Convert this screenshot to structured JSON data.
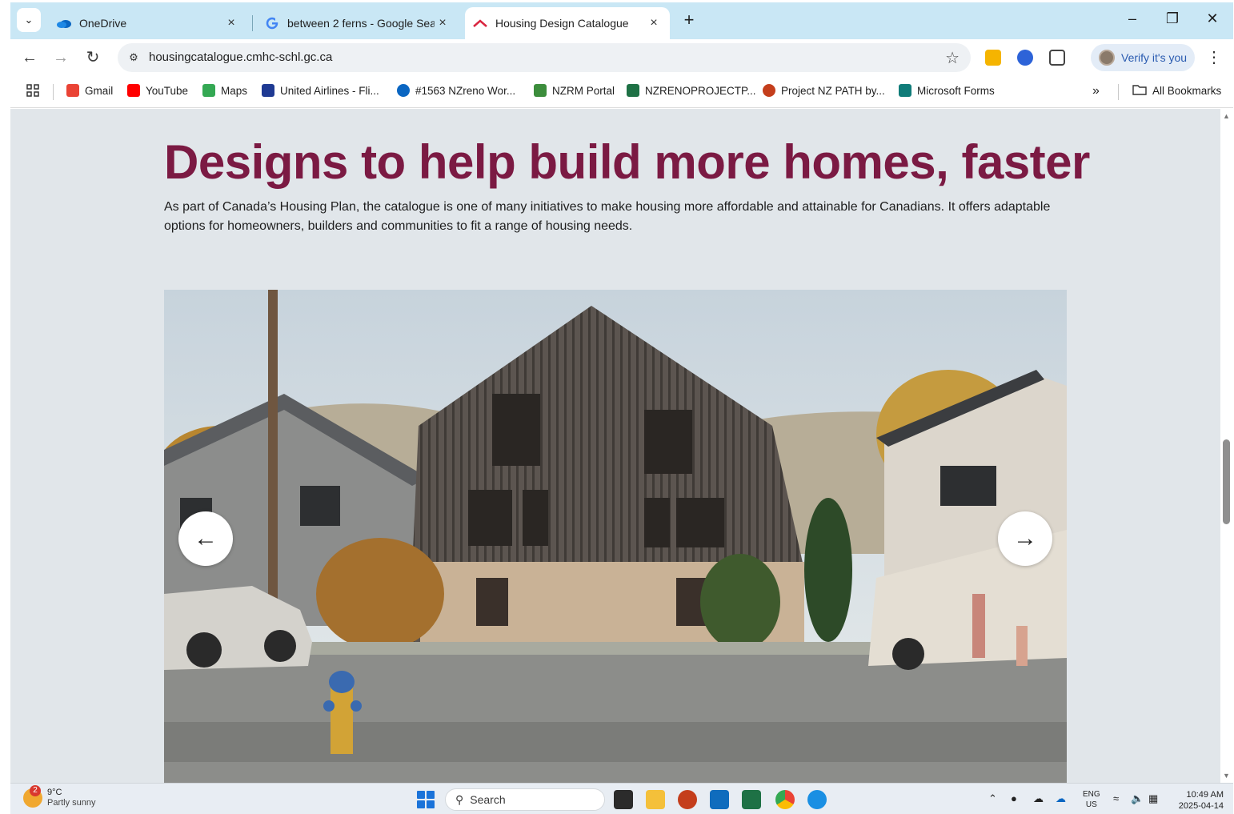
{
  "tabs": [
    {
      "title": "OneDrive",
      "icon": "onedrive-icon",
      "active": false
    },
    {
      "title": "between 2 ferns - Google Searc",
      "icon": "google-icon",
      "active": false
    },
    {
      "title": "Housing Design Catalogue",
      "icon": "cmhc-icon",
      "active": true
    }
  ],
  "tab_close_glyph": "×",
  "new_tab_glyph": "+",
  "address_bar": {
    "url": "housingcatalogue.cmhc-schl.gc.ca"
  },
  "profile": {
    "label": "Verify it's you"
  },
  "bookmarks": [
    {
      "label": "Gmail",
      "color": "#ea4335"
    },
    {
      "label": "YouTube",
      "color": "#ff0000"
    },
    {
      "label": "Maps",
      "color": "#34a853"
    },
    {
      "label": "United Airlines - Fli...",
      "color": "#1f3a93"
    },
    {
      "label": "#1563 NZreno Wor...",
      "color": "#0a66c2"
    },
    {
      "label": "NZRM Portal",
      "color": "#3c8d3c"
    },
    {
      "label": "NZRENOPROJECTP...",
      "color": "#1e7145"
    },
    {
      "label": "Project NZ PATH by...",
      "color": "#c43e1c"
    },
    {
      "label": "Microsoft Forms",
      "color": "#107c79"
    }
  ],
  "bookmarks_more": "»",
  "all_bookmarks": "All Bookmarks",
  "page": {
    "headline": "Designs to help build more homes, faster",
    "intro": "As part of Canada’s Housing Plan, the catalogue is one of many initiatives to make housing more affordable and attainable for Canadians. It offers adaptable options for homeowners, builders and communities to fit a range of housing needs.",
    "carousel_prev": "←",
    "carousel_next": "→"
  },
  "colors": {
    "headline": "#7b1a43",
    "page_bg": "#e1e6ea",
    "tabstrip": "#c9e7f5"
  },
  "taskbar": {
    "weather_temp": "9°C",
    "weather_condition": "Partly sunny",
    "weather_badge": "2",
    "search_placeholder": "Search",
    "lang_top": "ENG",
    "lang_bottom": "US",
    "time": "10:49 AM",
    "date": "2025-04-14"
  }
}
